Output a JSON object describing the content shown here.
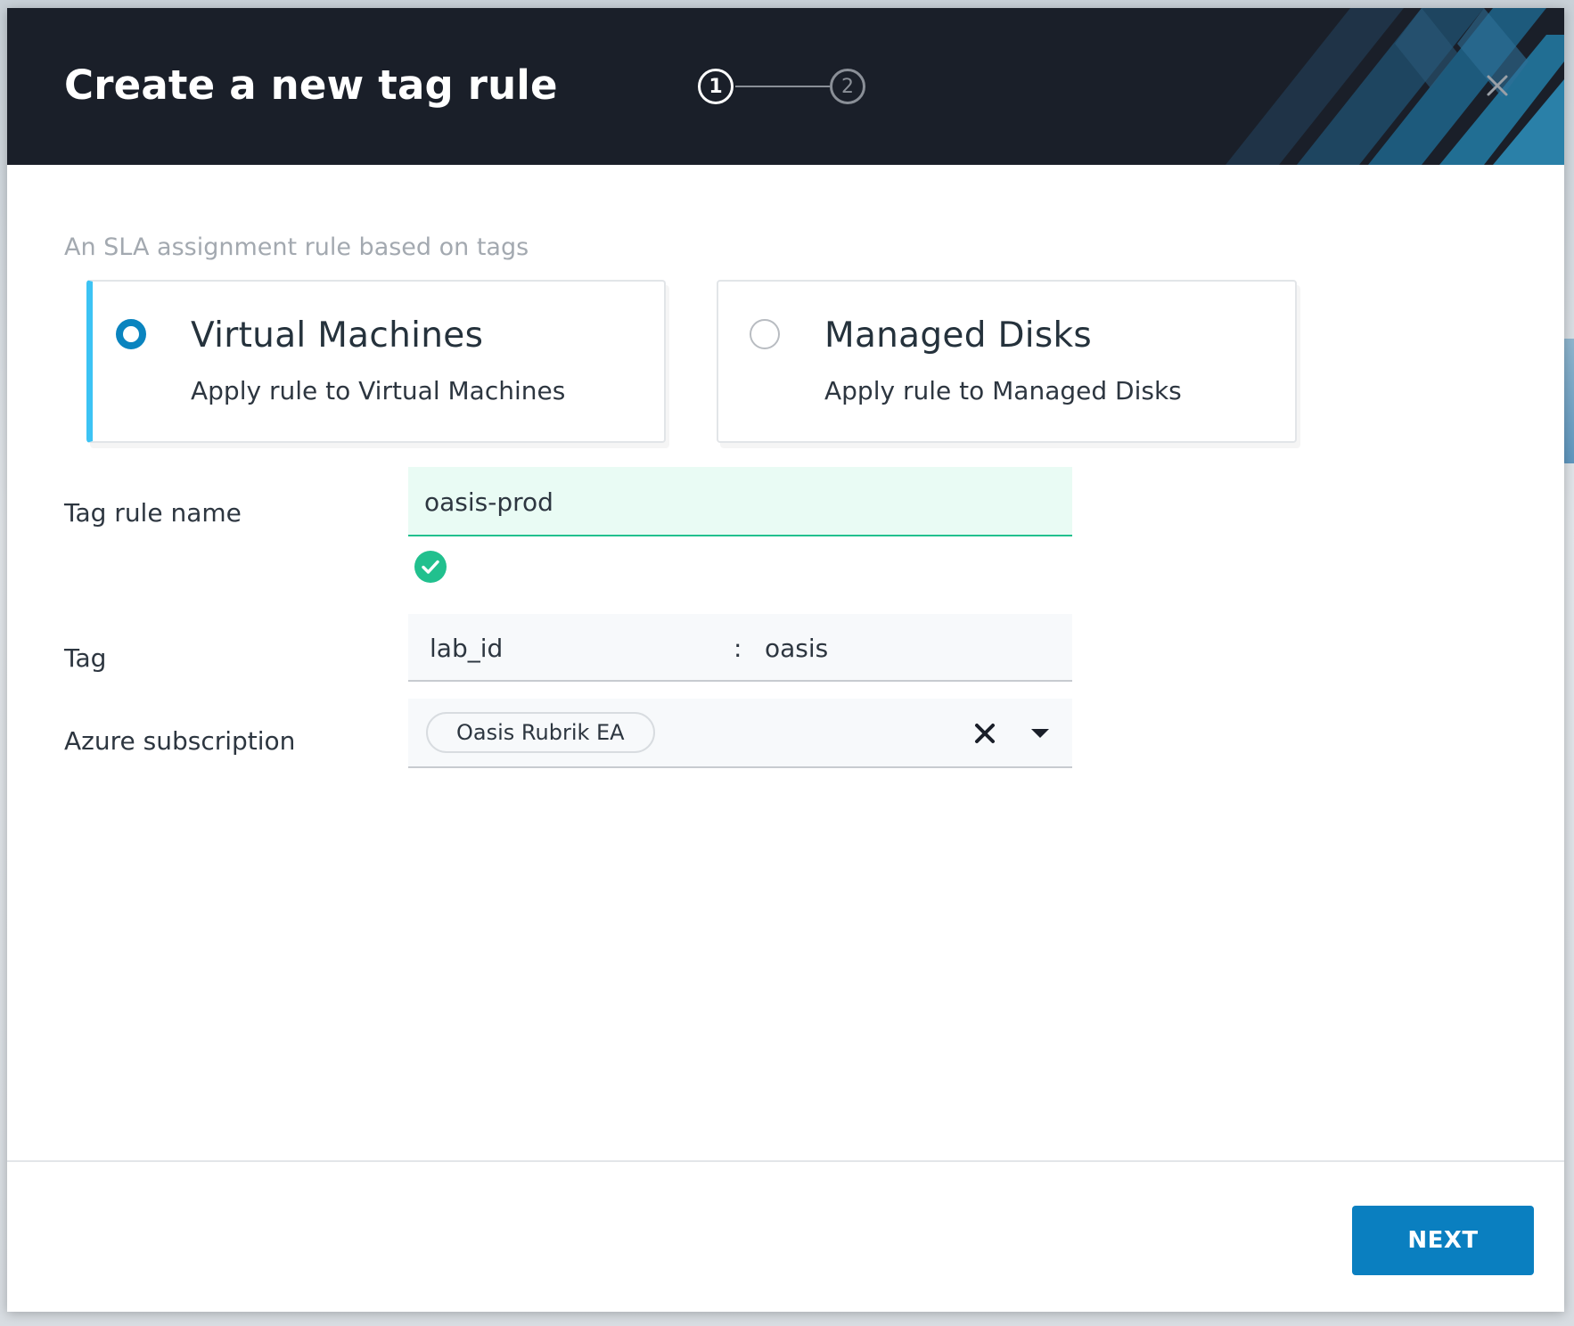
{
  "dialog": {
    "title": "Create a new tag rule",
    "steps": [
      "1",
      "2"
    ],
    "current_step": 1,
    "subtitle": "An SLA assignment rule based on tags"
  },
  "options": [
    {
      "title": "Virtual Machines",
      "description": "Apply rule to Virtual Machines",
      "selected": true
    },
    {
      "title": "Managed Disks",
      "description": "Apply rule to Managed Disks",
      "selected": false
    }
  ],
  "form": {
    "tag_rule_name": {
      "label": "Tag rule name",
      "value": "oasis-prod",
      "valid": true
    },
    "tag": {
      "label": "Tag",
      "key": "lab_id",
      "separator": ":",
      "value": "oasis"
    },
    "azure_subscription": {
      "label": "Azure subscription",
      "selected": "Oasis Rubrik EA"
    }
  },
  "footer": {
    "next_label": "NEXT"
  },
  "colors": {
    "header_bg": "#1a1f29",
    "accent_blue": "#0a84bf",
    "selected_bar": "#3cc3f4",
    "valid_green": "#21c08e",
    "button_blue": "#0a7fc0"
  },
  "icons": {
    "close": "close-icon",
    "valid": "check-circle-icon",
    "clear": "clear-x-icon",
    "dropdown": "caret-down-icon"
  }
}
